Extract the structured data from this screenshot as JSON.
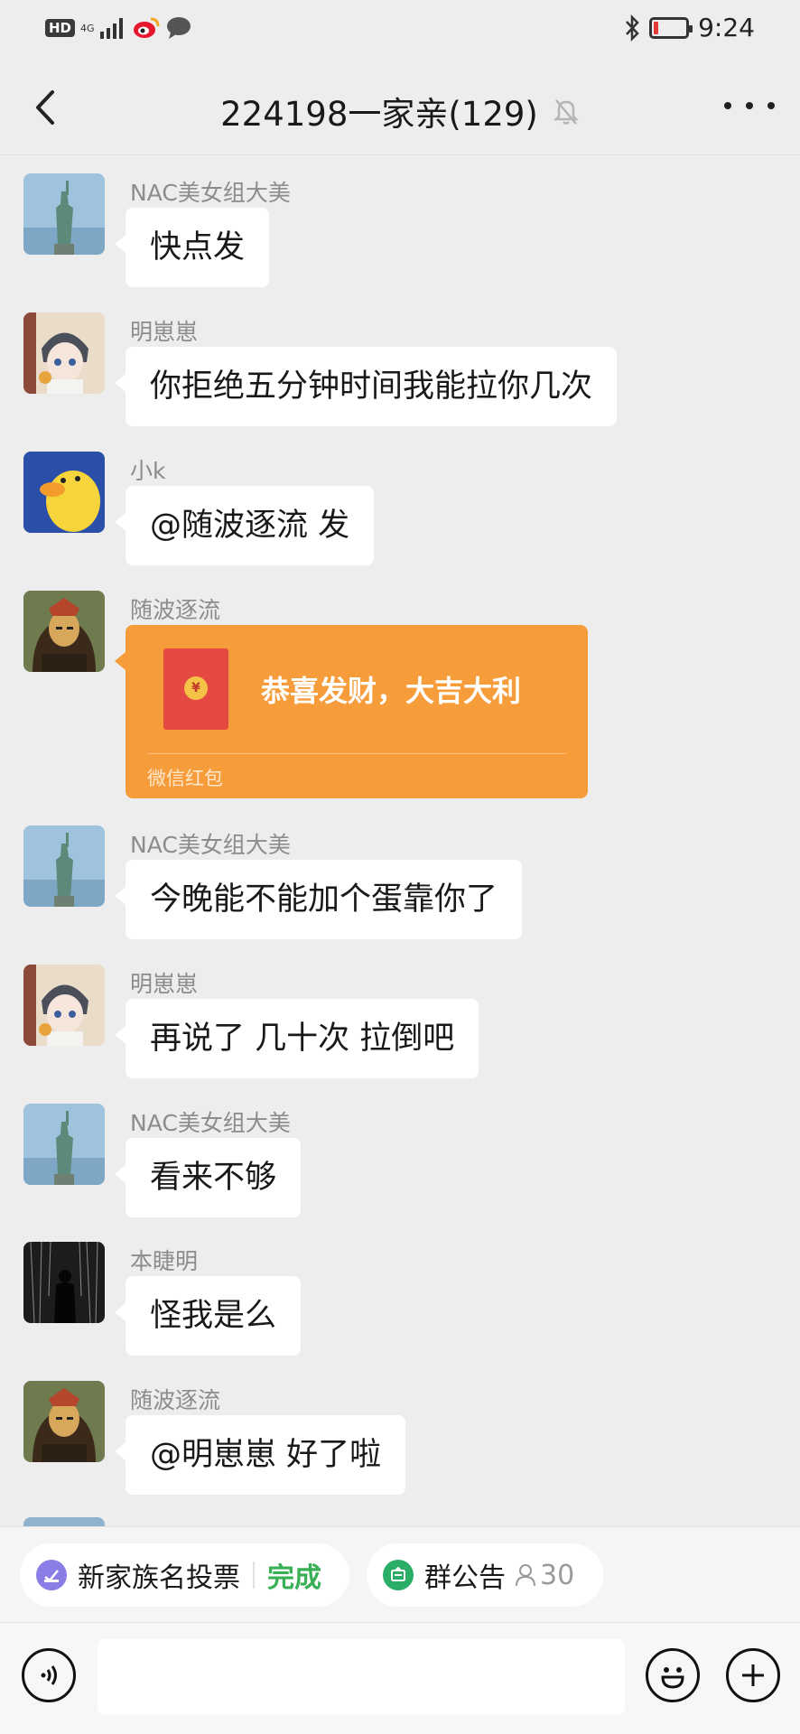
{
  "status_bar": {
    "hd": "HD",
    "network": "4G",
    "time": "9:24"
  },
  "header": {
    "title": "224198一家亲(129)"
  },
  "messages": [
    {
      "sender": "NAC美女组大美",
      "text": "快点发",
      "avatar": "statue-of-liberty-avatar"
    },
    {
      "sender": "明崽崽",
      "text": "你拒绝五分钟时间我能拉你几次",
      "avatar": "anime-boy-avatar"
    },
    {
      "sender": "小k",
      "text": "@随波逐流  发",
      "avatar": "yellow-duck-avatar"
    },
    {
      "sender": "随波逐流",
      "type": "red_packet",
      "text": "恭喜发财，大吉大利",
      "label": "微信红包",
      "avatar": "mona-lisa-avatar"
    },
    {
      "sender": "NAC美女组大美",
      "text": "今晚能不能加个蛋靠你了",
      "avatar": "statue-of-liberty-avatar"
    },
    {
      "sender": "明崽崽",
      "text": "再说了 几十次 拉倒吧",
      "avatar": "anime-boy-avatar"
    },
    {
      "sender": "NAC美女组大美",
      "text": "看来不够",
      "avatar": "statue-of-liberty-avatar"
    },
    {
      "sender": "本睫明",
      "text": "怪我是么",
      "avatar": "dark-figure-avatar"
    },
    {
      "sender": "随波逐流",
      "text": "@明崽崽  好了啦",
      "avatar": "mona-lisa-avatar"
    }
  ],
  "quick_bar": {
    "vote": {
      "label": "新家族名投票",
      "status": "完成"
    },
    "notice": {
      "label": "群公告",
      "count": "30"
    }
  },
  "colors": {
    "background": "#ededed",
    "red_packet": "#f79c3a",
    "done_green": "#3ab056",
    "notice_green": "#2aae67",
    "vote_purple": "#8b7de6"
  }
}
